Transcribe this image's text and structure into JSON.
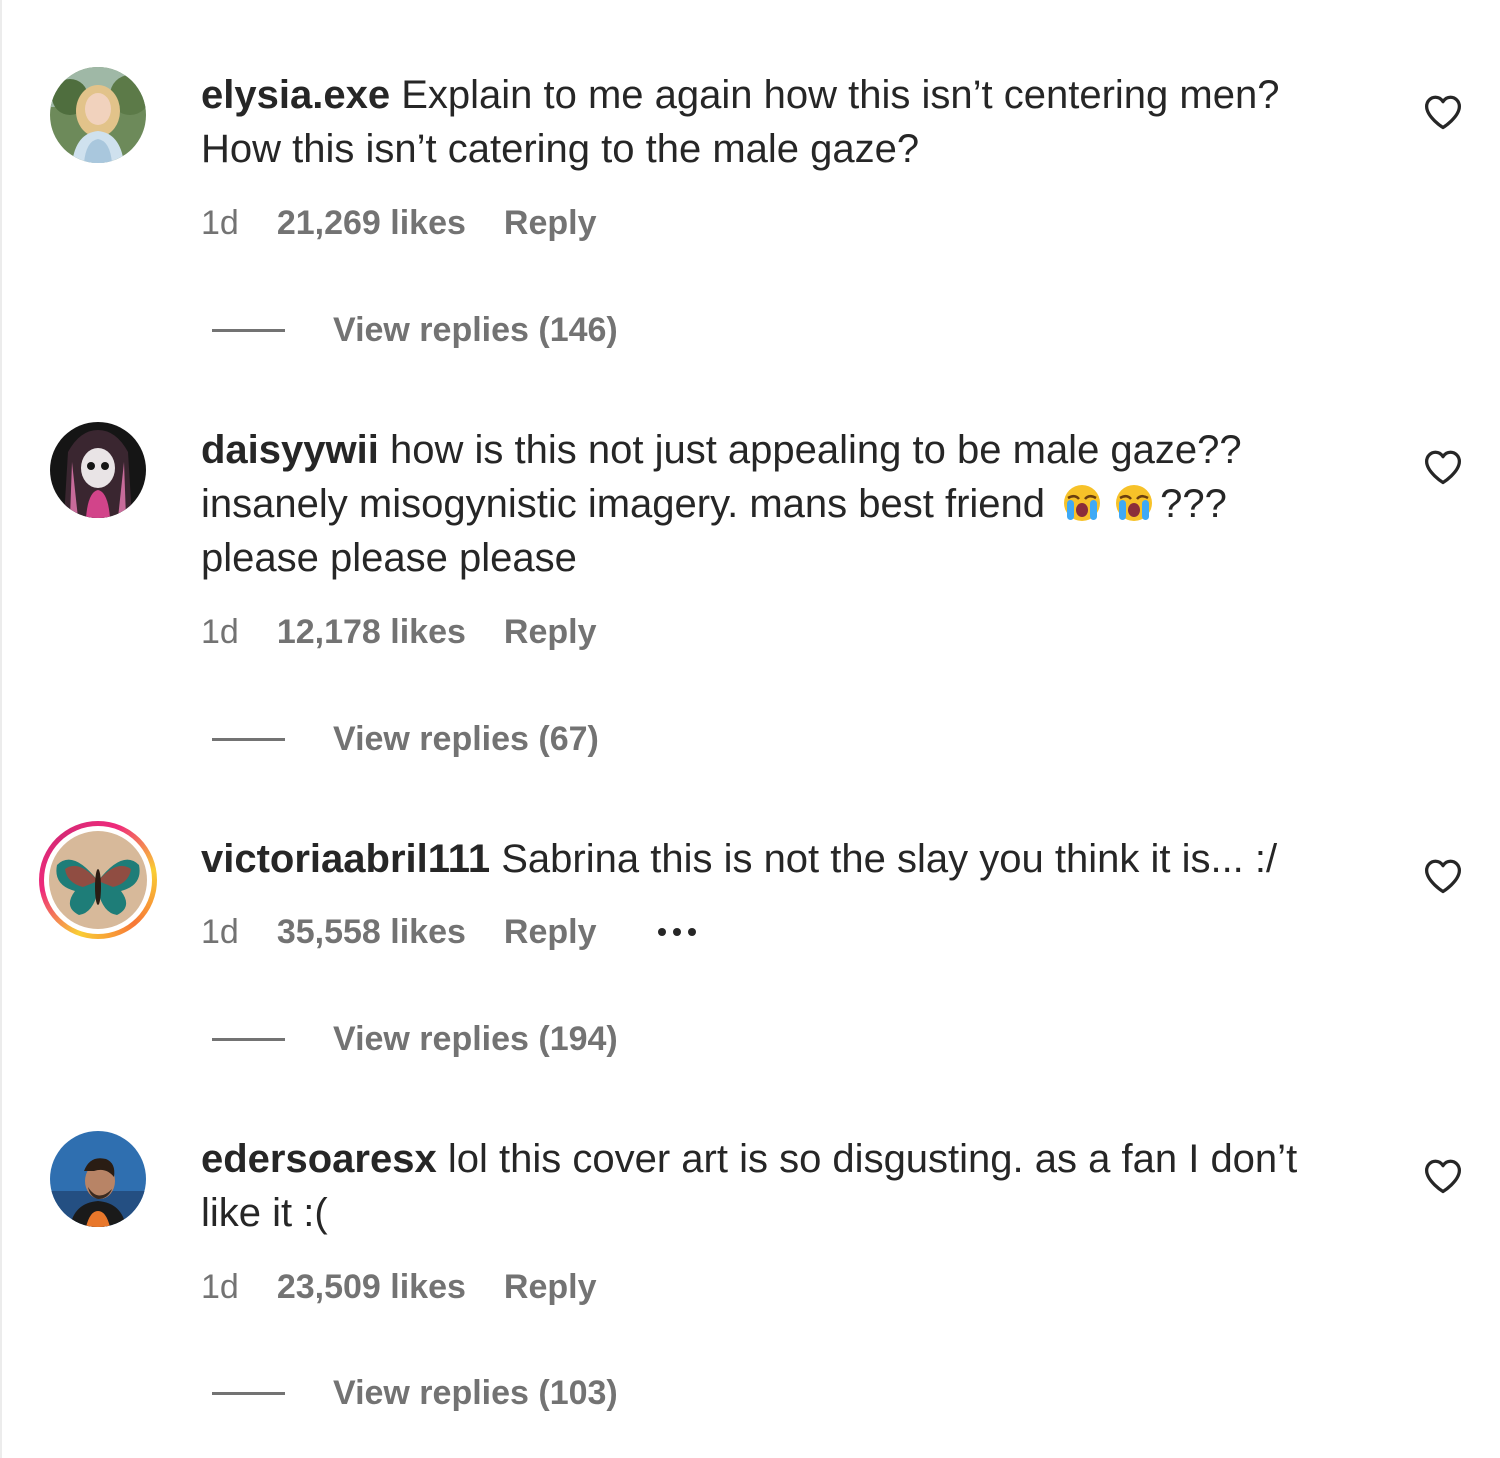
{
  "colors": {
    "text": "#262626",
    "secondary": "#737373",
    "background": "#ffffff"
  },
  "comments": [
    {
      "username": "elysia.exe",
      "text": "Explain to me again how this isn’t centering men? How this isn’t catering to the male gaze?",
      "time": "1d",
      "likes": "21,269 likes",
      "reply_label": "Reply",
      "view_replies": "View replies (146)",
      "avatar_icon": "avatar-photo-blonde-woman",
      "like_icon": "heart-outline-icon"
    },
    {
      "username": "daisyywii",
      "text_parts": [
        "how is this not just appealing to be male gaze?? insanely misogynistic imagery. mans best friend",
        "???",
        "please please please"
      ],
      "emojis": [
        "loudly-crying-face",
        "loudly-crying-face"
      ],
      "time": "1d",
      "likes": "12,178 likes",
      "reply_label": "Reply",
      "view_replies": "View replies (67)",
      "avatar_icon": "avatar-anime-doll",
      "like_icon": "heart-outline-icon"
    },
    {
      "username": "victoriaabril111",
      "text": "Sabrina this is not the slay you think it is... :/",
      "time": "1d",
      "likes": "35,558 likes",
      "reply_label": "Reply",
      "more_icon": "more-options-icon",
      "view_replies": "View replies (194)",
      "avatar_icon": "avatar-butterfly-with-story-ring",
      "like_icon": "heart-outline-icon"
    },
    {
      "username": "edersoaresx",
      "text": "lol this cover art is so disgusting. as a fan I don’t like it :(",
      "time": "1d",
      "likes": "23,509 likes",
      "reply_label": "Reply",
      "view_replies": "View replies (103)",
      "avatar_icon": "avatar-man-blue-background",
      "like_icon": "heart-outline-icon"
    }
  ]
}
